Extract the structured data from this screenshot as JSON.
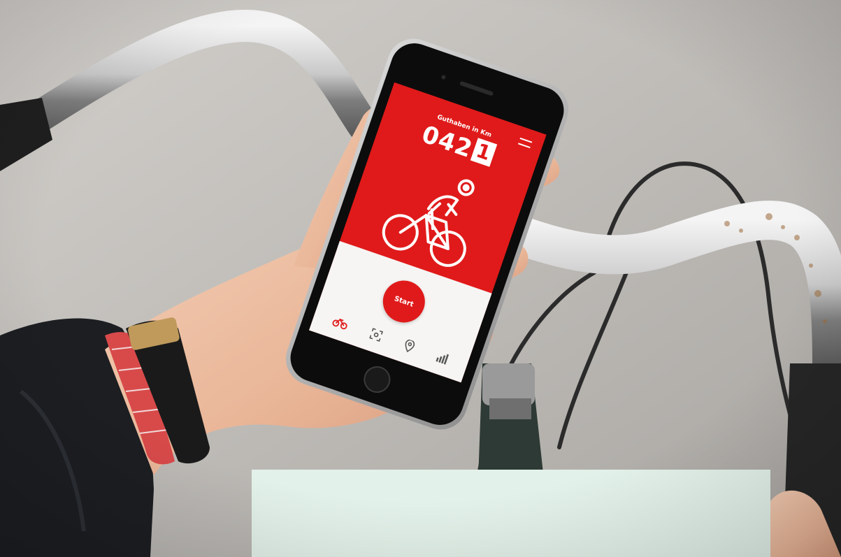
{
  "app": {
    "balance_label": "Guthaben in Km",
    "counter_digits": "042",
    "counter_last_digit": "1",
    "start_button_label": "Start",
    "nav_icons": [
      "bike-icon",
      "scan-icon",
      "location-pin-icon",
      "stats-icon"
    ],
    "menu_icon": "hamburger-menu-icon"
  },
  "colors": {
    "app_red": "#e01a1a",
    "panel_mint": "#e2f1e9",
    "nav_active": "#e01a1a",
    "nav_inactive": "#555555"
  }
}
